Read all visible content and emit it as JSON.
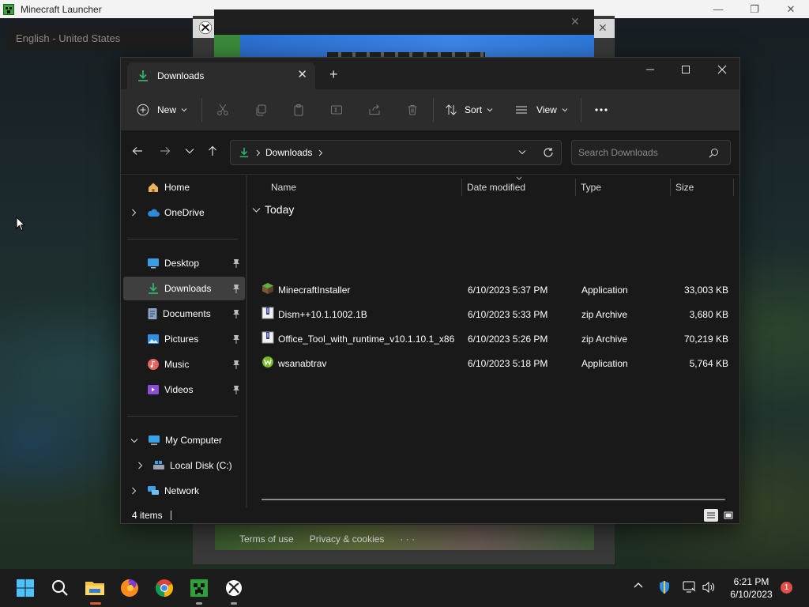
{
  "launcher": {
    "title": "Minecraft Launcher",
    "language": "English - United States",
    "footer": {
      "terms": "Terms of use",
      "privacy": "Privacy & cookies",
      "more": "· · ·"
    }
  },
  "explorer": {
    "tab_title": "Downloads",
    "toolbar": {
      "new_label": "New",
      "sort_label": "Sort",
      "view_label": "View"
    },
    "address": {
      "path": "Downloads"
    },
    "search": {
      "placeholder": "Search Downloads"
    },
    "sidebar": {
      "items": [
        {
          "label": "Home",
          "icon": "home-icon"
        },
        {
          "label": "OneDrive",
          "icon": "cloud-icon"
        },
        {
          "label": "Desktop",
          "icon": "desktop-icon",
          "pinned": true
        },
        {
          "label": "Downloads",
          "icon": "download-icon",
          "pinned": true,
          "selected": true
        },
        {
          "label": "Documents",
          "icon": "document-icon",
          "pinned": true
        },
        {
          "label": "Pictures",
          "icon": "picture-icon",
          "pinned": true
        },
        {
          "label": "Music",
          "icon": "music-icon",
          "pinned": true
        },
        {
          "label": "Videos",
          "icon": "video-icon",
          "pinned": true
        },
        {
          "label": "My Computer",
          "icon": "computer-icon"
        },
        {
          "label": "Local Disk (C:)",
          "icon": "drive-icon"
        },
        {
          "label": "Network",
          "icon": "network-icon"
        }
      ]
    },
    "columns": {
      "name": "Name",
      "date": "Date modified",
      "type": "Type",
      "size": "Size"
    },
    "group_label": "Today",
    "files": [
      {
        "name": "MinecraftInstaller",
        "date": "6/10/2023 5:37 PM",
        "type": "Application",
        "size": "33,003 KB",
        "icon": "minecraft-block-icon"
      },
      {
        "name": "Dism++10.1.1002.1B",
        "date": "6/10/2023 5:33 PM",
        "type": "zip Archive",
        "size": "3,680 KB",
        "icon": "zip-icon"
      },
      {
        "name": "Office_Tool_with_runtime_v10.1.10.1_x86",
        "date": "6/10/2023 5:26 PM",
        "type": "zip Archive",
        "size": "70,219 KB",
        "icon": "zip-icon"
      },
      {
        "name": "wsanabtrav",
        "date": "6/10/2023 5:18 PM",
        "type": "Application",
        "size": "5,764 KB",
        "icon": "app-icon"
      }
    ],
    "status": {
      "item_count": "4 items"
    }
  },
  "taskbar": {
    "clock_time": "6:21 PM",
    "clock_date": "6/10/2023",
    "notification_count": "1"
  },
  "colors": {
    "accent_green": "#2fb36d",
    "selection": "#3f3f3f",
    "notif_red": "#e0504a"
  }
}
